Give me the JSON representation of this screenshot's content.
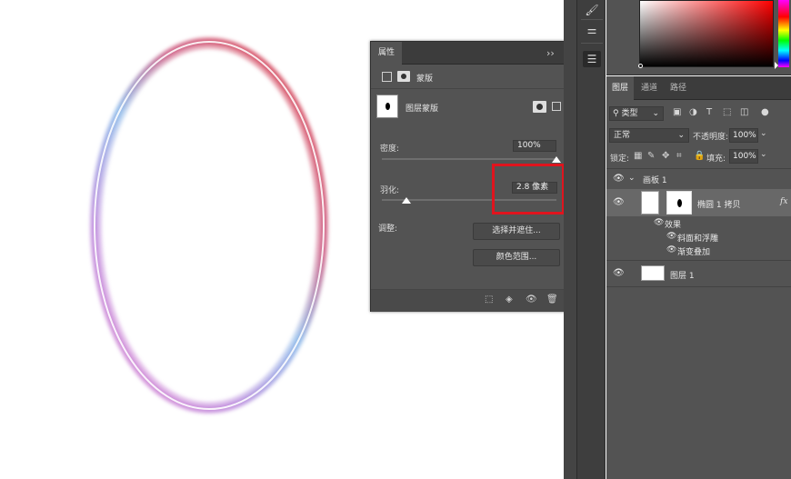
{
  "properties_panel": {
    "title": "属性",
    "mask_label": "蒙版",
    "layer_mask_label": "图层蒙版",
    "density_label": "密度:",
    "density_value": "100%",
    "density_level": 1.0,
    "feather_label": "羽化:",
    "feather_value": "2.8 像素",
    "feather_level": 0.02,
    "adjust_label": "调整:",
    "select_and_mask_button": "选择并遮住...",
    "color_range_button": "颜色范围...",
    "highlight_color": "#e0141e"
  },
  "layers_panel": {
    "tabs": [
      "图层",
      "通道",
      "路径"
    ],
    "active_tab": "图层",
    "filter_kind": "类型",
    "blend_mode": "正常",
    "opacity_label": "不透明度:",
    "opacity_value": "100%",
    "lock_label": "锁定:",
    "fill_label": "填充:",
    "fill_value": "100%",
    "artboard_name": "画板 1",
    "layer_copy_name": "椭圆 1 拷贝",
    "fx_label": "fx",
    "effects_label": "效果",
    "effect_1": "斜面和浮雕",
    "effect_2": "渐变叠加",
    "layer_1_name": "图层 1"
  },
  "icons": [
    "brush-icon",
    "sliders-icon",
    "adjust-icon",
    "eye-icon",
    "trash-icon",
    "lock-icon",
    "mask-icon"
  ]
}
